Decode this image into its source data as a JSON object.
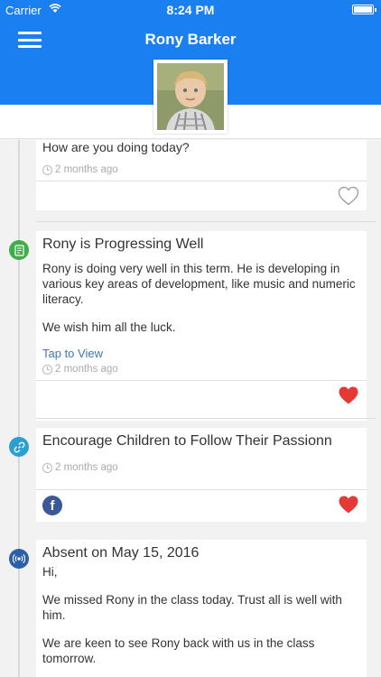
{
  "status_bar": {
    "carrier": "Carrier",
    "time": "8:24 PM"
  },
  "header": {
    "title": "Rony Barker"
  },
  "feed": [
    {
      "partial_text": "How are you doing today?",
      "time": "2 months ago",
      "liked": false
    },
    {
      "title": "Rony is Progressing Well",
      "body": "Rony is doing very well in this term. He is developing in various key areas of development, like music and numeric literacy.",
      "body2": "We wish him all the luck.",
      "link": "Tap to View",
      "time": "2 months ago",
      "liked": true,
      "icon": "document-icon",
      "icon_color": "#3fae49"
    },
    {
      "title": "Encourage Children to Follow Their Passionn",
      "time": "2 months ago",
      "liked": true,
      "icon": "link-icon",
      "icon_color": "#2a9fd0",
      "share": "facebook-icon"
    },
    {
      "title": "Absent on May 15, 2016",
      "greeting": "Hi,",
      "body": "We missed Rony in the class today. Trust all is well with him.",
      "body2": "We are keen to see Rony back with us in the class tomorrow.",
      "icon": "broadcast-icon",
      "icon_color": "#2d5fa8"
    }
  ],
  "colors": {
    "brand": "#1a7ff0",
    "heart": "#e53935"
  }
}
